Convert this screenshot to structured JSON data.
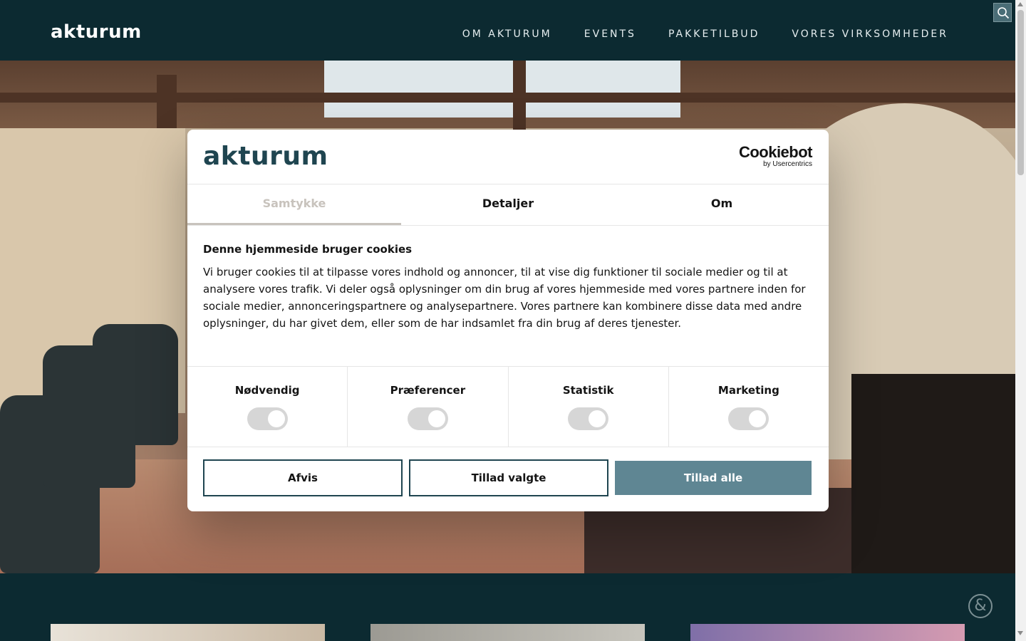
{
  "header": {
    "logo": "akturum",
    "nav": [
      "OM AKTURUM",
      "EVENTS",
      "PAKKETILBUD",
      "VORES VIRKSOMHEDER"
    ],
    "search_icon": "search-icon"
  },
  "dialog": {
    "logo": "akturum",
    "provider": {
      "name": "Cookiebot",
      "sub": "by Usercentrics"
    },
    "tabs": [
      "Samtykke",
      "Detaljer",
      "Om"
    ],
    "active_tab": "Samtykke",
    "title": "Denne hjemmeside bruger cookies",
    "text": "Vi bruger cookies til at tilpasse vores indhold og annoncer, til at vise dig funktioner til sociale medier og til at analysere vores trafik. Vi deler også oplysninger om din brug af vores hjemmeside med vores partnere inden for sociale medier, annonceringspartnere og analysepartnere. Vores partnere kan kombinere disse data med andre oplysninger, du har givet dem, eller som de har indsamlet fra din brug af deres tjenester.",
    "categories": [
      {
        "label": "Nødvendig",
        "enabled": true
      },
      {
        "label": "Præferencer",
        "enabled": true
      },
      {
        "label": "Statistik",
        "enabled": true
      },
      {
        "label": "Marketing",
        "enabled": true
      }
    ],
    "buttons": {
      "decline": "Afvis",
      "allow_selected": "Tillad valgte",
      "allow_all": "Tillad alle"
    }
  },
  "colors": {
    "header_bg": "#0c2a31",
    "brand_text": "#1f4550",
    "accept_button": "#5f8693"
  }
}
